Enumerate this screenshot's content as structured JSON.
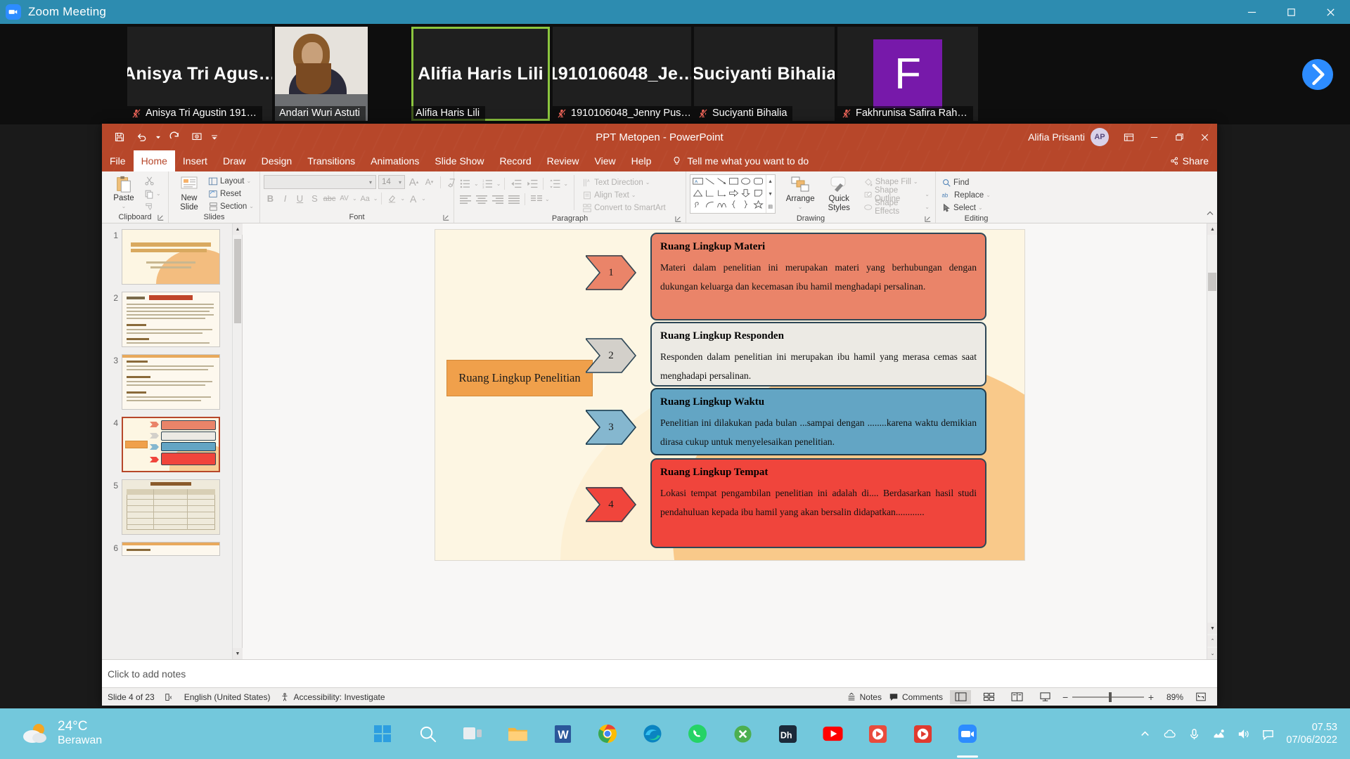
{
  "zoom": {
    "window_title": "Zoom Meeting",
    "logo_icon": "zoom-video-icon",
    "minimize_icon": "minimize-icon",
    "maximize_icon": "maximize-icon",
    "close_icon": "close-icon",
    "next_page_icon": "chevron-right-icon",
    "participants": [
      {
        "display_name": "Anisya Tri Agus…",
        "label": "Anisya Tri Agustin 191…",
        "muted": true,
        "active": false,
        "kind": "name"
      },
      {
        "display_name": "",
        "label": "Andari Wuri Astuti",
        "muted": false,
        "active": false,
        "kind": "photo"
      },
      {
        "display_name": "Alifia Haris Lili",
        "label": "Alifia Haris Lili",
        "muted": false,
        "active": true,
        "kind": "name"
      },
      {
        "display_name": "1910106048_Je…",
        "label": "1910106048_Jenny Pus…",
        "muted": true,
        "active": false,
        "kind": "name"
      },
      {
        "display_name": "Suciyanti Bihalia",
        "label": "Suciyanti Bihalia",
        "muted": true,
        "active": false,
        "kind": "name"
      },
      {
        "display_name": "F",
        "label": "Fakhrunisa Safira Rah…",
        "muted": true,
        "active": false,
        "kind": "avatar",
        "avatar_color": "#7719aa"
      }
    ]
  },
  "powerpoint": {
    "title": "PPT Metopen  -  PowerPoint",
    "user_name": "Alifia Prisanti",
    "user_initials": "AP",
    "quick_access": [
      {
        "name": "save-button",
        "icon": "save-icon"
      },
      {
        "name": "undo-button",
        "icon": "undo-icon"
      },
      {
        "name": "redo-button",
        "icon": "redo-icon"
      },
      {
        "name": "start-presentation-button",
        "icon": "presentation-icon"
      },
      {
        "name": "customize-qat-button",
        "icon": "chevron-down-icon"
      }
    ],
    "title_right_icons": [
      {
        "name": "ribbon-display-options-button",
        "icon": "ribbon-options-icon"
      },
      {
        "name": "minimize-button",
        "icon": "minimize-icon"
      },
      {
        "name": "restore-button",
        "icon": "restore-icon"
      },
      {
        "name": "close-button",
        "icon": "close-icon"
      }
    ],
    "tabs": [
      "File",
      "Home",
      "Insert",
      "Draw",
      "Design",
      "Transitions",
      "Animations",
      "Slide Show",
      "Record",
      "Review",
      "View",
      "Help"
    ],
    "selected_tab": "Home",
    "tell_me": "Tell me what you want to do",
    "share_label": "Share",
    "ribbon": {
      "clipboard": {
        "title": "Clipboard",
        "paste": "Paste",
        "cut": "cut-icon",
        "copy": "copy-icon",
        "format_painter": "format-painter-icon"
      },
      "slides": {
        "title": "Slides",
        "new_slide": "New\nSlide",
        "new_slide_line1": "New",
        "new_slide_line2": "Slide",
        "layout": "Layout",
        "reset": "Reset",
        "section": "Section"
      },
      "font": {
        "title": "Font",
        "font_name": "",
        "font_size": "14",
        "bold": "B",
        "italic": "I",
        "underline": "U",
        "strikethrough": "S",
        "text_shadow": "abc",
        "char_spacing": "AV",
        "change_case": "Aa",
        "grow_font": "A",
        "shrink_font": "A",
        "clear_formatting": "clear-formatting-icon",
        "text_highlight": "highlight-icon",
        "font_color": "A"
      },
      "paragraph": {
        "title": "Paragraph",
        "text_direction": "Text Direction",
        "align_text": "Align Text",
        "convert_smartart": "Convert to SmartArt"
      },
      "drawing": {
        "title": "Drawing",
        "arrange": "Arrange",
        "quick_styles_line1": "Quick",
        "quick_styles_line2": "Styles",
        "shape_fill": "Shape Fill",
        "shape_outline": "Shape Outline",
        "shape_effects": "Shape Effects"
      },
      "editing": {
        "title": "Editing",
        "find": "Find",
        "replace": "Replace",
        "select": "Select"
      }
    },
    "thumbnails": [
      {
        "number": "1",
        "selected": false
      },
      {
        "number": "2",
        "selected": false
      },
      {
        "number": "3",
        "selected": false
      },
      {
        "number": "4",
        "selected": true
      },
      {
        "number": "5",
        "selected": false
      },
      {
        "number": "6",
        "selected": false
      }
    ],
    "slide": {
      "main_label": "Ruang Lingkup Penelitian",
      "items": [
        {
          "number": "1",
          "heading": "Ruang Lingkup Materi",
          "body": "Materi dalam penelitian ini merupakan materi yang berhubungan dengan dukungan keluarga dan kecemasan ibu hamil menghadapi persalinan.",
          "fill": "#ea8469",
          "chevron_fill": "#ea8469",
          "border": "#2e4756"
        },
        {
          "number": "2",
          "heading": "Ruang Lingkup Responden",
          "body": "Responden dalam penelitian ini merupakan ibu hamil yang merasa cemas saat menghadapi persalinan.",
          "fill": "#eceae4",
          "chevron_fill": "#d3d0ca",
          "border": "#2e4756"
        },
        {
          "number": "3",
          "heading": "Ruang Lingkup Waktu",
          "body": "Penelitian ini dilakukan pada bulan ...sampai dengan ........karena waktu demikian dirasa cukup untuk menyelesaikan penelitian.",
          "fill": "#63a5c4",
          "chevron_fill": "#85b7cf",
          "border": "#1d3b4d"
        },
        {
          "number": "4",
          "heading": "Ruang Lingkup Tempat",
          "body": "Lokasi tempat pengambilan penelitian ini adalah di.... Berdasarkan hasil studi pendahuluan kepada ibu hamil yang akan bersalin didapatkan............",
          "fill": "#f0453c",
          "chevron_fill": "#f0453c",
          "border": "#2e4756"
        }
      ]
    },
    "notes_placeholder": "Click to add notes",
    "status": {
      "slide_counter": "Slide 4 of 23",
      "language": "English (United States)",
      "accessibility": "Accessibility: Investigate",
      "notes_button": "Notes",
      "comments_button": "Comments",
      "zoom_level": "89%",
      "view_buttons": [
        {
          "name": "normal-view-button",
          "icon": "normal-view-icon",
          "selected": true
        },
        {
          "name": "slide-sorter-button",
          "icon": "slide-sorter-icon",
          "selected": false
        },
        {
          "name": "reading-view-button",
          "icon": "reading-view-icon",
          "selected": false
        },
        {
          "name": "slide-show-button",
          "icon": "slide-show-icon",
          "selected": false
        }
      ],
      "fit_slide_icon": "fit-to-window-icon",
      "zoom_out_icon": "minus-icon",
      "zoom_in_icon": "plus-icon"
    }
  },
  "taskbar": {
    "weather_temp": "24°C",
    "weather_cond": "Berawan",
    "weather_icon": "partly-cloudy-icon",
    "time": "07.53",
    "date": "07/06/2022",
    "apps": [
      {
        "name": "start-button",
        "icon": "windows-logo-icon",
        "color": "#2d9ee0"
      },
      {
        "name": "search-button",
        "icon": "search-icon",
        "color": "#ffffff"
      },
      {
        "name": "task-view-button",
        "icon": "task-view-icon",
        "color": "#e8e8e8"
      },
      {
        "name": "file-explorer-button",
        "icon": "folder-icon",
        "color": "#f5b33c"
      },
      {
        "name": "word-button",
        "icon": "word-icon",
        "color": "#2b579a"
      },
      {
        "name": "chrome-button",
        "icon": "chrome-icon",
        "color": "#4285f4"
      },
      {
        "name": "edge-button",
        "icon": "edge-icon",
        "color": "#0078d7"
      },
      {
        "name": "whatsapp-button",
        "icon": "whatsapp-icon",
        "color": "#25d366"
      },
      {
        "name": "xsplit-button",
        "icon": "xsplit-icon",
        "color": "#4caf50"
      },
      {
        "name": "idm-button",
        "icon": "idm-icon",
        "color": "#1b2a3a"
      },
      {
        "name": "youtube-button",
        "icon": "youtube-icon",
        "color": "#ff0000"
      },
      {
        "name": "media-player-button",
        "icon": "media-player-icon",
        "color": "#e94b3c"
      },
      {
        "name": "video-player-button",
        "icon": "video-player-icon",
        "color": "#e03a2f"
      },
      {
        "name": "zoom-taskbar-button",
        "icon": "zoom-icon",
        "color": "#2d8cff"
      }
    ],
    "tray": [
      {
        "name": "show-hidden-icons-button",
        "icon": "chevron-up-icon"
      },
      {
        "name": "onedrive-icon",
        "icon": "cloud-icon"
      },
      {
        "name": "microphone-icon",
        "icon": "microphone-icon"
      },
      {
        "name": "network-icon",
        "icon": "network-icon"
      },
      {
        "name": "volume-icon",
        "icon": "speaker-icon"
      },
      {
        "name": "action-center-icon",
        "icon": "notification-icon"
      }
    ]
  }
}
